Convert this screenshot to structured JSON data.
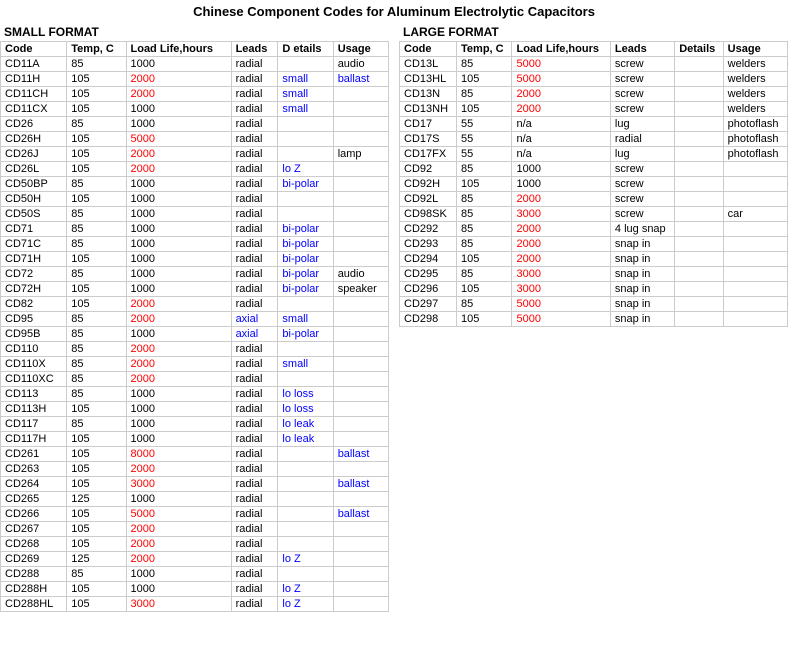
{
  "title": "Chinese Component Codes for Aluminum Electrolytic Capacitors",
  "small_format": {
    "label": "SMALL FORMAT",
    "headers": [
      "Code",
      "Temp, C",
      "Load Life,hours",
      "Leads",
      "D etails",
      "Usage"
    ],
    "rows": [
      [
        "CD11A",
        "85",
        "1000",
        "radial",
        "",
        "audio"
      ],
      [
        "CD11H",
        "105",
        "2000",
        "radial",
        "small",
        "ballast"
      ],
      [
        "CD11CH",
        "105",
        "2000",
        "radial",
        "small",
        ""
      ],
      [
        "CD11CX",
        "105",
        "1000",
        "radial",
        "small",
        ""
      ],
      [
        "CD26",
        "85",
        "1000",
        "radial",
        "",
        ""
      ],
      [
        "CD26H",
        "105",
        "5000",
        "radial",
        "",
        ""
      ],
      [
        "CD26J",
        "105",
        "2000",
        "radial",
        "",
        "lamp"
      ],
      [
        "CD26L",
        "105",
        "2000",
        "radial",
        "lo Z",
        ""
      ],
      [
        "CD50BP",
        "85",
        "1000",
        "radial",
        "bi-polar",
        ""
      ],
      [
        "CD50H",
        "105",
        "1000",
        "radial",
        "",
        ""
      ],
      [
        "CD50S",
        "85",
        "1000",
        "radial",
        "",
        ""
      ],
      [
        "CD71",
        "85",
        "1000",
        "radial",
        "bi-polar",
        ""
      ],
      [
        "CD71C",
        "85",
        "1000",
        "radial",
        "bi-polar",
        ""
      ],
      [
        "CD71H",
        "105",
        "1000",
        "radial",
        "bi-polar",
        ""
      ],
      [
        "CD72",
        "85",
        "1000",
        "radial",
        "bi-polar",
        "audio"
      ],
      [
        "CD72H",
        "105",
        "1000",
        "radial",
        "bi-polar",
        "speaker"
      ],
      [
        "CD82",
        "105",
        "2000",
        "radial",
        "",
        ""
      ],
      [
        "CD95",
        "85",
        "2000",
        "axial",
        "small",
        ""
      ],
      [
        "CD95B",
        "85",
        "1000",
        "axial",
        "bi-polar",
        ""
      ],
      [
        "CD110",
        "85",
        "2000",
        "radial",
        "",
        ""
      ],
      [
        "CD110X",
        "85",
        "2000",
        "radial",
        "small",
        ""
      ],
      [
        "CD110XC",
        "85",
        "2000",
        "radial",
        "",
        ""
      ],
      [
        "CD113",
        "85",
        "1000",
        "radial",
        "lo loss",
        ""
      ],
      [
        "CD113H",
        "105",
        "1000",
        "radial",
        "lo loss",
        ""
      ],
      [
        "CD117",
        "85",
        "1000",
        "radial",
        "lo leak",
        ""
      ],
      [
        "CD117H",
        "105",
        "1000",
        "radial",
        "lo leak",
        ""
      ],
      [
        "CD261",
        "105",
        "8000",
        "radial",
        "",
        "ballast"
      ],
      [
        "CD263",
        "105",
        "2000",
        "radial",
        "",
        ""
      ],
      [
        "CD264",
        "105",
        "3000",
        "radial",
        "",
        "ballast"
      ],
      [
        "CD265",
        "125",
        "1000",
        "radial",
        "",
        ""
      ],
      [
        "CD266",
        "105",
        "5000",
        "radial",
        "",
        "ballast"
      ],
      [
        "CD267",
        "105",
        "2000",
        "radial",
        "",
        ""
      ],
      [
        "CD268",
        "105",
        "2000",
        "radial",
        "",
        ""
      ],
      [
        "CD269",
        "125",
        "2000",
        "radial",
        "lo Z",
        ""
      ],
      [
        "CD288",
        "85",
        "1000",
        "radial",
        "",
        ""
      ],
      [
        "CD288H",
        "105",
        "1000",
        "radial",
        "lo Z",
        ""
      ],
      [
        "CD288HL",
        "105",
        "3000",
        "radial",
        "lo Z",
        ""
      ]
    ]
  },
  "large_format": {
    "label": "LARGE FORMAT",
    "headers": [
      "Code",
      "Temp, C",
      "Load Life,hours",
      "Leads",
      "Details",
      "Usage"
    ],
    "rows": [
      [
        "CD13L",
        "85",
        "5000",
        "screw",
        "",
        "welders"
      ],
      [
        "CD13HL",
        "105",
        "5000",
        "screw",
        "",
        "welders"
      ],
      [
        "CD13N",
        "85",
        "2000",
        "screw",
        "",
        "welders"
      ],
      [
        "CD13NH",
        "105",
        "2000",
        "screw",
        "",
        "welders"
      ],
      [
        "CD17",
        "55",
        "n/a",
        "lug",
        "",
        "photoflash"
      ],
      [
        "CD17S",
        "55",
        "n/a",
        "radial",
        "",
        "photoflash"
      ],
      [
        "CD17FX",
        "55",
        "n/a",
        "lug",
        "",
        "photoflash"
      ],
      [
        "CD92",
        "85",
        "1000",
        "screw",
        "",
        ""
      ],
      [
        "CD92H",
        "105",
        "1000",
        "screw",
        "",
        ""
      ],
      [
        "CD92L",
        "85",
        "2000",
        "screw",
        "",
        ""
      ],
      [
        "CD98SK",
        "85",
        "3000",
        "screw",
        "",
        "car"
      ],
      [
        "CD292",
        "85",
        "2000",
        "4 lug snap",
        "",
        ""
      ],
      [
        "CD293",
        "85",
        "2000",
        "snap in",
        "",
        ""
      ],
      [
        "CD294",
        "105",
        "2000",
        "snap in",
        "",
        ""
      ],
      [
        "CD295",
        "85",
        "3000",
        "snap in",
        "",
        ""
      ],
      [
        "CD296",
        "105",
        "3000",
        "snap in",
        "",
        ""
      ],
      [
        "CD297",
        "85",
        "5000",
        "snap in",
        "",
        ""
      ],
      [
        "CD298",
        "105",
        "5000",
        "snap in",
        "",
        ""
      ]
    ]
  }
}
